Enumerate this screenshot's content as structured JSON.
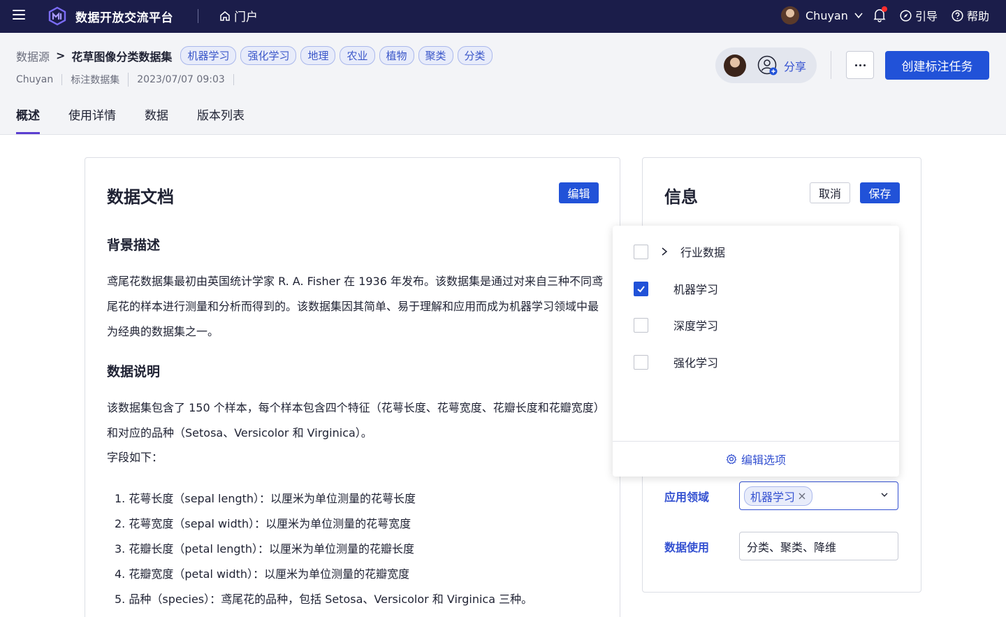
{
  "topbar": {
    "brand": "数据开放交流平台",
    "portal": "门户",
    "user_name": "Chuyan",
    "guide": "引导",
    "help": "帮助"
  },
  "breadcrumb": {
    "root": "数据源",
    "sep": ">",
    "current": "花草图像分类数据集",
    "tags": [
      "机器学习",
      "强化学习",
      "地理",
      "农业",
      "植物",
      "聚类",
      "分类"
    ]
  },
  "meta": {
    "owner": "Chuyan",
    "type": "标注数据集",
    "datetime": "2023/07/07 09:03"
  },
  "actions": {
    "share": "分享",
    "create": "创建标注任务"
  },
  "tabs": [
    "概述",
    "使用详情",
    "数据",
    "版本列表"
  ],
  "doc": {
    "title": "数据文档",
    "edit": "编辑",
    "section1_title": "背景描述",
    "section1_text": "鸢尾花数据集最初由英国统计学家 R. A. Fisher 在 1936 年发布。该数据集是通过对来自三种不同鸢尾花的样本进行测量和分析而得到的。该数据集因其简单、易于理解和应用而成为机器学习领域中最为经典的数据集之一。",
    "section2_title": "数据说明",
    "section2_text": "该数据集包含了 150 个样本，每个样本包含四个特征（花萼长度、花萼宽度、花瓣长度和花瓣宽度）和对应的品种（Setosa、Versicolor 和 Virginica）。",
    "fields_intro": "字段如下：",
    "fields": [
      "花萼长度（sepal length）：以厘米为单位测量的花萼长度",
      "花萼宽度（sepal width）：以厘米为单位测量的花萼宽度",
      "花瓣长度（petal length）：以厘米为单位测量的花瓣长度",
      "花瓣宽度（petal width）：以厘米为单位测量的花瓣宽度",
      "品种（species）：鸢尾花的品种，包括 Setosa、Versicolor 和 Virginica 三种。"
    ]
  },
  "info": {
    "title": "信息",
    "cancel": "取消",
    "save": "保存",
    "field_domain_label": "应用领域",
    "field_domain_value": "机器学习",
    "field_usage_label": "数据使用",
    "field_usage_value": "分类、聚类、降维"
  },
  "dropdown": {
    "options": [
      {
        "label": "行业数据",
        "checked": false,
        "expandable": true
      },
      {
        "label": "机器学习",
        "checked": true,
        "expandable": false
      },
      {
        "label": "深度学习",
        "checked": false,
        "expandable": false
      },
      {
        "label": "强化学习",
        "checked": false,
        "expandable": false
      }
    ],
    "footer": "编辑选项"
  },
  "colors": {
    "nav_bg": "#1b1d4a",
    "primary": "#2152d8",
    "accent_text": "#3451d1",
    "tab_indicator": "#5b3fd0",
    "notification": "#ff2d2d"
  }
}
